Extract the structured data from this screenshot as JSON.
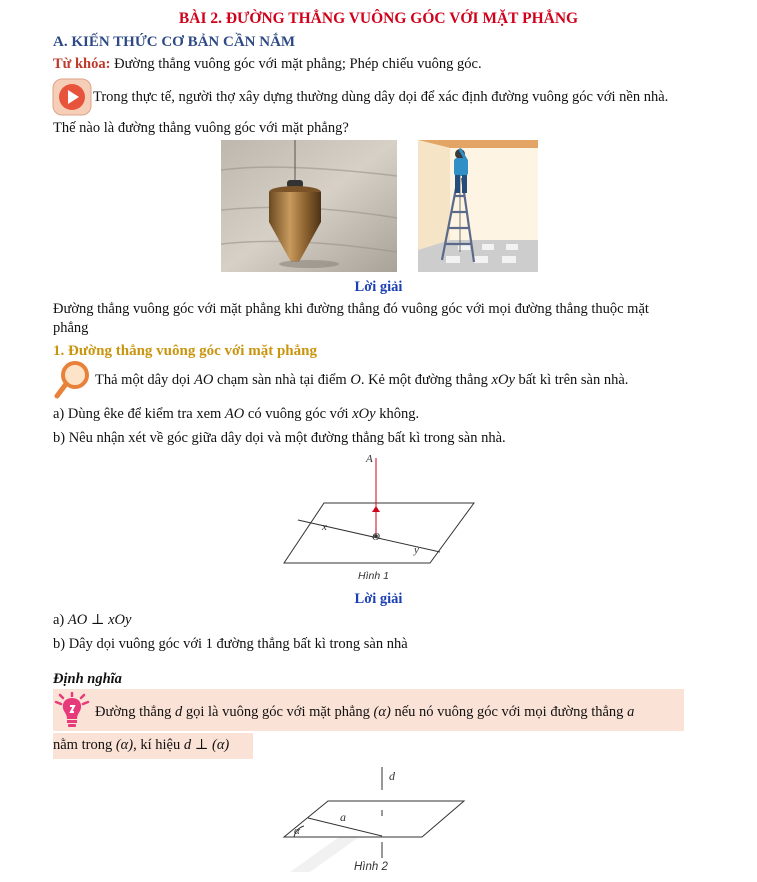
{
  "title": "BÀI 2. ĐƯỜNG THẲNG VUÔNG GÓC VỚI MẶT PHẲNG",
  "section_a": "A. KIẾN THỨC CƠ BẢN CẦN NẮM",
  "keyword_label": "Từ khóa:",
  "keyword_text": " Đường thẳng vuông góc với mặt phẳng; Phép chiếu vuông góc.",
  "intro_line1": "Trong thực tế, người thợ xây dựng thường dùng dây dọi để xác định đường vuông góc với nền nhà.",
  "intro_line2": "Thế nào là đường thẳng vuông góc với mặt phẳng?",
  "loi_giai": "Lời giải",
  "answer1_line1": "Đường thẳng vuông góc với mặt phẳng khi đường thẳng đó vuông góc với mọi đường thẳng thuộc mặt",
  "answer1_line2": "phẳng",
  "sub1": "1. Đường thẳng vuông góc với mặt phẳng",
  "activity": {
    "p1": "Thả một dây dọi ",
    "ao": "AO",
    "p2": " chạm sàn nhà tại điểm ",
    "o": "O",
    "p3": ". Kẻ một đường thẳng ",
    "xoy": "xOy",
    "p4": " bất kì trên sàn nhà."
  },
  "qa": {
    "p1": "a) Dùng êke để kiểm tra xem ",
    "ao": "AO",
    "p2": " có vuông góc với ",
    "xoy": "xOy",
    "p3": " không."
  },
  "qb": "b) Nêu nhận xét về góc giữa dây dọi và một đường thẳng bất kì trong sàn nhà.",
  "fig1": {
    "A": "A",
    "x": "x",
    "O": "O",
    "y": "y",
    "caption": "Hình 1"
  },
  "ans_a": {
    "prefix": "a) ",
    "math": "AO ⊥ xOy"
  },
  "ans_b": "b) Dây dọi vuông góc với 1 đường thẳng bất kì trong sàn nhà",
  "def_title": "Định nghĩa",
  "def": {
    "p1": "Đường thẳng ",
    "d": "d",
    "p2": " gọi là vuông góc với mặt phẳng ",
    "alpha": "(α)",
    "p3": " nếu nó vuông góc với mọi đường thẳng ",
    "a": "a",
    "line2_p1": "nằm trong ",
    "line2_alpha": "(α)",
    "line2_p2": ", kí hiệu ",
    "line2_math": "d ⊥ (α)"
  },
  "fig2": {
    "d": "d",
    "a": "a",
    "alpha": "α",
    "caption": "Hình 2"
  },
  "colors": {
    "title": "#d0021b",
    "section": "#2e4a86",
    "keyword": "#c0392b",
    "gold": "#c9950f",
    "blue": "#1a3fb5",
    "pink": "#fbe2d6"
  },
  "icons": [
    "play-icon",
    "magnifier-icon",
    "lightbulb-icon"
  ]
}
